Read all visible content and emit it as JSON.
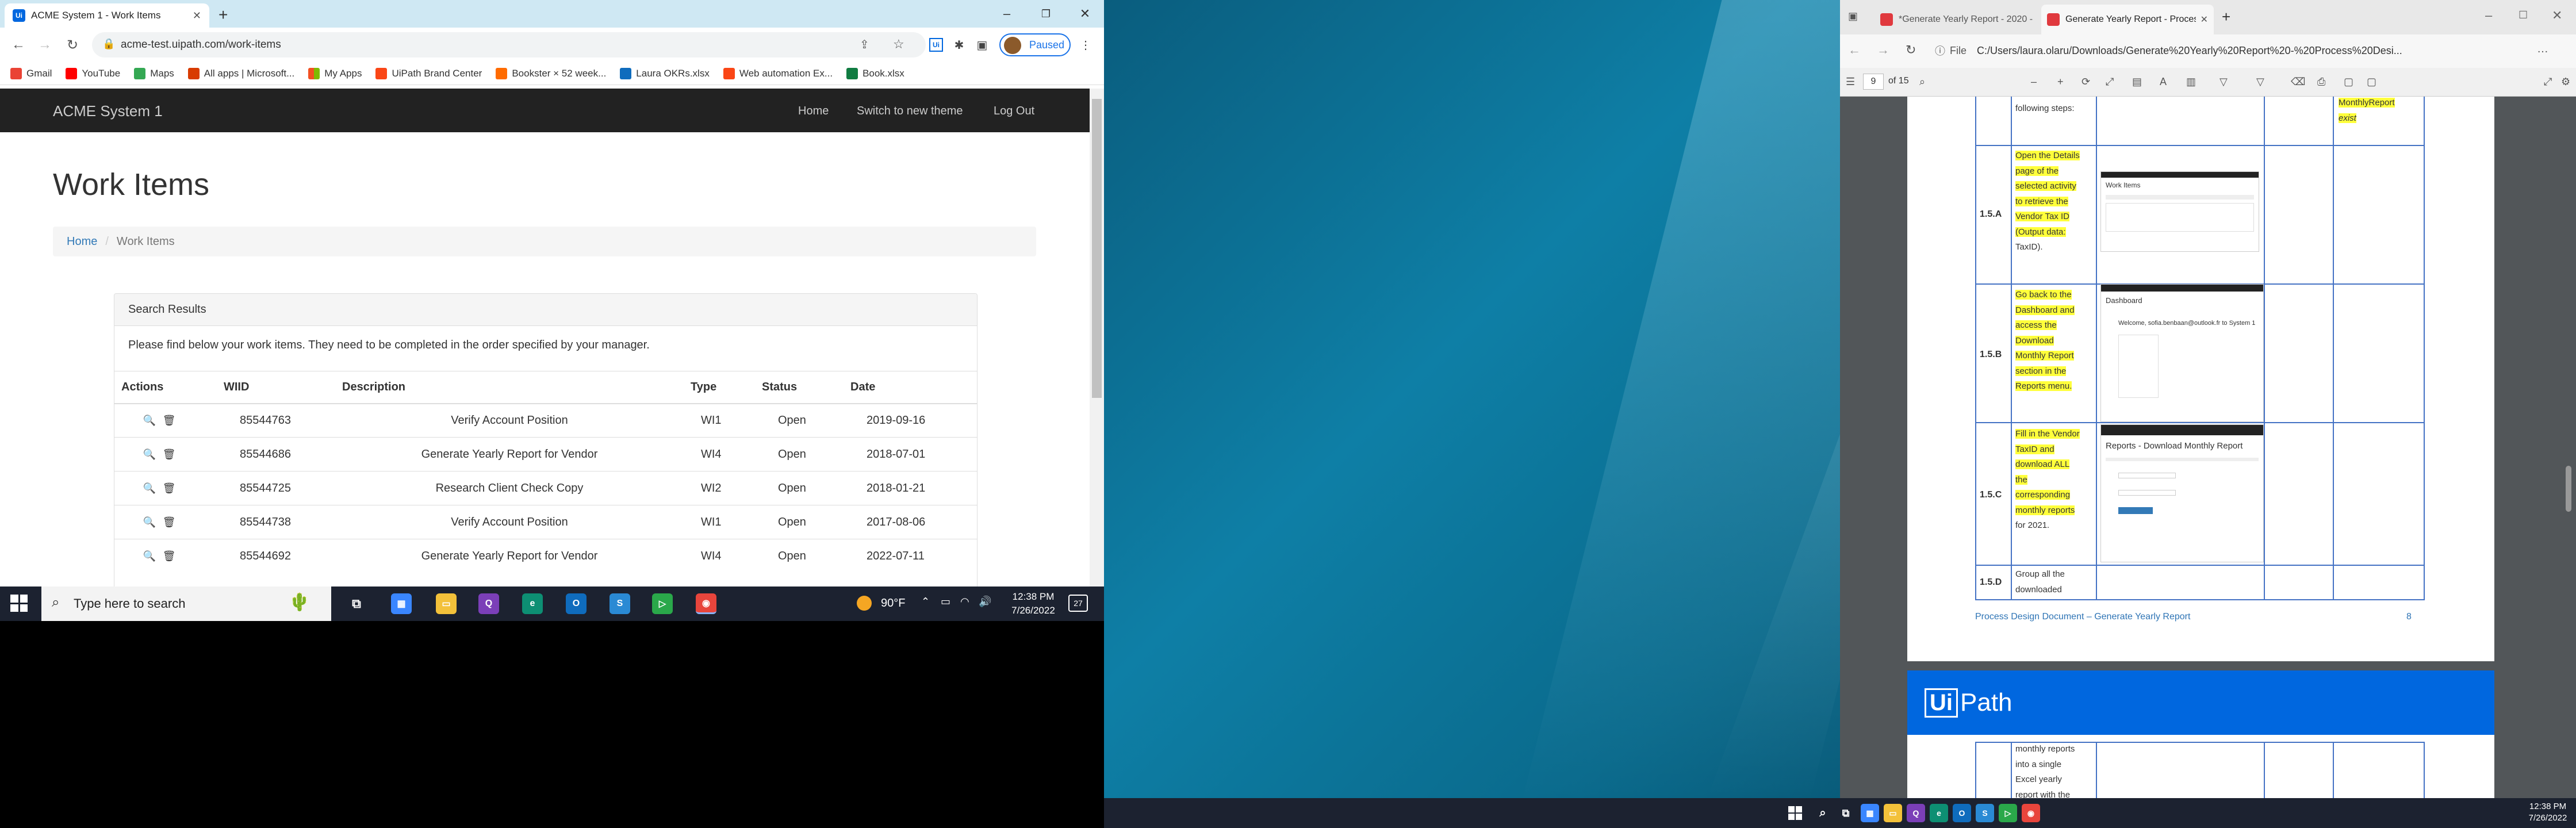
{
  "left_browser": {
    "tabs": [
      {
        "title": "ACME System 1 - Work Items",
        "icon": "uipath-favicon"
      }
    ],
    "new_tab_label": "+",
    "address": "acme-test.uipath.com/work-items",
    "profile_status": "Paused",
    "bookmarks": [
      {
        "label": "Gmail",
        "color": "#ea4335"
      },
      {
        "label": "YouTube",
        "color": "#ff0000"
      },
      {
        "label": "Maps",
        "color": "#34a853"
      },
      {
        "label": "All apps | Microsoft...",
        "color": "#d83b01"
      },
      {
        "label": "My Apps",
        "color": "#f25022"
      },
      {
        "label": "UiPath Brand Center",
        "color": "#fa4616"
      },
      {
        "label": "Bookster × 52 week...",
        "color": "#ff6b00"
      },
      {
        "label": "Laura OKRs.xlsx",
        "color": "#0f6cbd"
      },
      {
        "label": "Web automation Ex...",
        "color": "#fa4616"
      },
      {
        "label": "Book.xlsx",
        "color": "#107c41"
      }
    ]
  },
  "acme": {
    "brand": "ACME System 1",
    "nav": [
      "Home",
      "Switch to new theme",
      "Log Out"
    ],
    "page_title": "Work Items",
    "breadcrumb": {
      "home": "Home",
      "separator": "/",
      "current": "Work Items"
    },
    "panel_title": "Search Results",
    "panel_note": "Please find below your work items. They need to be completed in the order specified by your manager.",
    "columns": [
      "Actions",
      "WIID",
      "Description",
      "Type",
      "Status",
      "Date"
    ],
    "rows": [
      {
        "wiid": "85544763",
        "description": "Verify Account Position",
        "type": "WI1",
        "status": "Open",
        "date": "2019-09-16"
      },
      {
        "wiid": "85544686",
        "description": "Generate Yearly Report for Vendor",
        "type": "WI4",
        "status": "Open",
        "date": "2018-07-01"
      },
      {
        "wiid": "85544725",
        "description": "Research Client Check Copy",
        "type": "WI2",
        "status": "Open",
        "date": "2018-01-21"
      },
      {
        "wiid": "85544738",
        "description": "Verify Account Position",
        "type": "WI1",
        "status": "Open",
        "date": "2017-08-06"
      },
      {
        "wiid": "85544692",
        "description": "Generate Yearly Report for Vendor",
        "type": "WI4",
        "status": "Open",
        "date": "2022-07-11"
      }
    ]
  },
  "left_taskbar": {
    "search_placeholder": "Type here to search",
    "weather": "90°F",
    "time": "12:38 PM",
    "date": "7/26/2022",
    "notifications": "27"
  },
  "pdf_browser": {
    "tabs": [
      {
        "title": "*Generate Yearly Report - 2020 -",
        "active": false
      },
      {
        "title": "Generate Yearly Report - Proces",
        "active": true
      }
    ],
    "address_prefix": "File",
    "address": "C:/Users/laura.olaru/Downloads/Generate%20Yearly%20Report%20-%20Process%20Desi...",
    "page_number": "9",
    "page_total": "of 15"
  },
  "pdf": {
    "top_left_text": "following steps:",
    "top_right_text": [
      "MonthlyReport",
      "exist"
    ],
    "steps": [
      {
        "id": "1.5.A",
        "lines": [
          "Open the Details",
          "page of the",
          "selected activity",
          "to retrieve the",
          "Vendor Tax ID",
          "(Output data:",
          "TaxID)."
        ],
        "highlight_count": 6
      },
      {
        "id": "1.5.B",
        "lines": [
          "Go back to the",
          "Dashboard and",
          "access the",
          "Download",
          "Monthly Report",
          "section in the",
          "Reports menu."
        ],
        "highlight_count": 7
      },
      {
        "id": "1.5.C",
        "lines": [
          "Fill in the Vendor",
          "TaxID and",
          "download ALL",
          "the",
          "corresponding",
          "monthly reports",
          "for 2021."
        ],
        "highlight_count": 6
      },
      {
        "id": "1.5.D",
        "lines": [
          "Group all the",
          "downloaded"
        ],
        "highlight_count": 0
      }
    ],
    "thumb_a": {
      "title": "Work Items"
    },
    "thumb_b": {
      "title": "Dashboard",
      "welcome": "Welcome, sofia.benbaan@outlook.fr to System 1"
    },
    "thumb_c": {
      "title": "Reports - Download Monthly Report"
    },
    "footer": "Process Design Document – Generate Yearly Report",
    "page_num": "8",
    "page2_lines": [
      "monthly reports",
      "into a single",
      "Excel yearly",
      "report with the"
    ],
    "logo_left": "Ui",
    "logo_right": "Path"
  },
  "right_taskbar": {
    "time": "12:38 PM",
    "date": "7/26/2022"
  }
}
